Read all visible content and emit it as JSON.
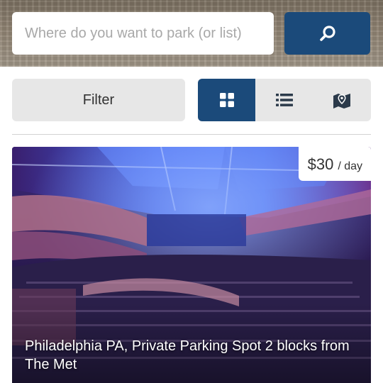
{
  "search": {
    "placeholder": "Where do you want to park (or list)",
    "button_icon": "search-icon"
  },
  "toolbar": {
    "filter_label": "Filter",
    "views": [
      {
        "name": "grid",
        "icon": "grid-icon",
        "active": true
      },
      {
        "name": "list",
        "icon": "list-icon",
        "active": false
      },
      {
        "name": "map",
        "icon": "map-icon",
        "active": false
      }
    ]
  },
  "listing": {
    "price": "$30",
    "price_unit": "/ day",
    "title": "Philadelphia PA, Private Parking Spot 2 blocks from The Met"
  },
  "colors": {
    "primary": "#1b4a7a",
    "control_bg": "#e7e7e7",
    "text": "#333333",
    "placeholder": "#a8a8a8"
  }
}
